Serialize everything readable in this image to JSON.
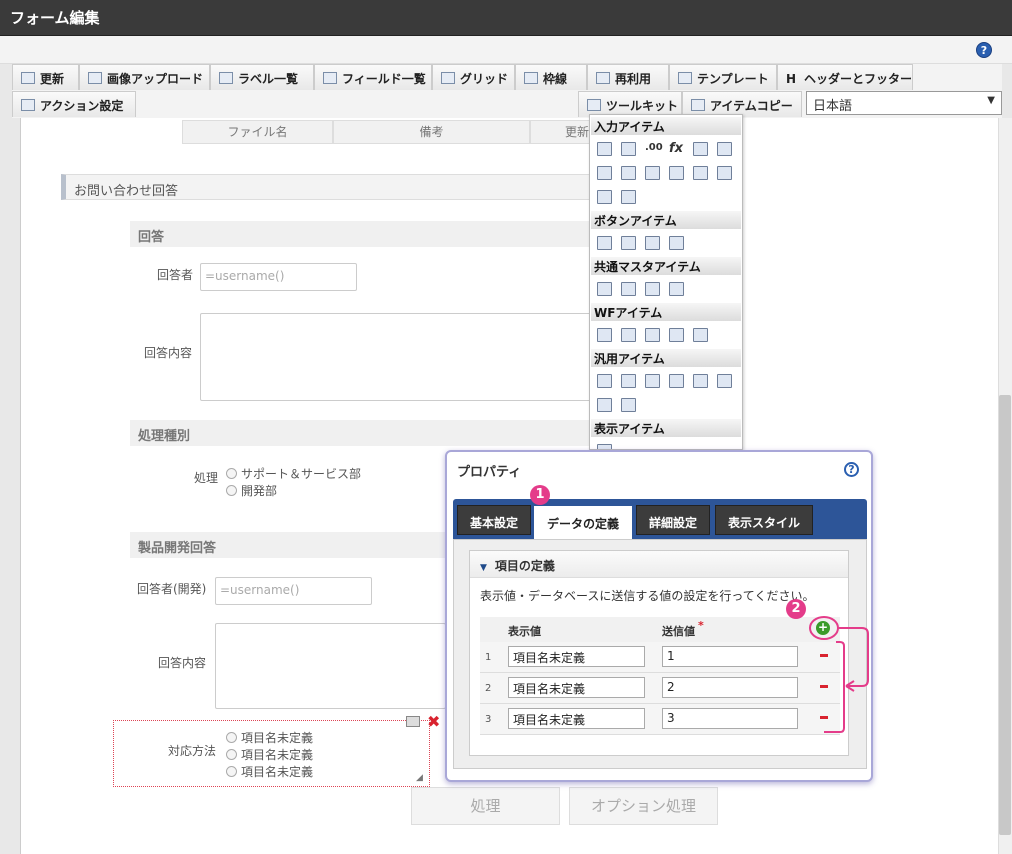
{
  "window": {
    "title": "フォーム編集",
    "help": "?"
  },
  "toolbar": {
    "row1": [
      "更新",
      "画像アップロード",
      "ラベル一覧",
      "フィールド一覧",
      "グリッド",
      "枠線",
      "再利用",
      "テンプレート",
      "ヘッダーとフッター"
    ],
    "header_footer_prefix": "H",
    "row2_left": "アクション設定",
    "row2_right": [
      "ツールキット",
      "アイテムコピー"
    ],
    "language": "日本語"
  },
  "form": {
    "grid_headers": [
      "ファイル名",
      "備考",
      "更新"
    ],
    "section_title": "お問い合わせ回答",
    "subsections": [
      "回答",
      "処理種別",
      "製品開発回答"
    ],
    "responder_label": "回答者",
    "responder_value": "=username()",
    "response_label": "回答内容",
    "process_label": "処理",
    "process_options": [
      "サポート＆サービス部",
      "開発部"
    ],
    "dev_responder_label": "回答者(開発)",
    "dev_responder_value": "=username()",
    "dev_response_label": "回答内容",
    "method_label": "対応方法",
    "method_options": [
      "項目名未定義",
      "項目名未定義",
      "項目名未定義"
    ],
    "buttons": [
      "処理",
      "オプション処理"
    ]
  },
  "palette": {
    "categories": [
      "入力アイテム",
      "ボタンアイテム",
      "共通マスタアイテム",
      "WFアイテム",
      "汎用アイテム",
      "表示アイテム"
    ]
  },
  "properties": {
    "title": "プロパティ",
    "help": "?",
    "tabs": [
      "基本設定",
      "データの定義",
      "詳細設定",
      "表示スタイル"
    ],
    "section": "項目の定義",
    "description": "表示値・データベースに送信する値の設定を行ってください。",
    "columns": [
      "表示値",
      "送信値"
    ],
    "required_mark": "*",
    "rows": [
      {
        "num": "1",
        "display": "項目名未定義",
        "value": "1"
      },
      {
        "num": "2",
        "display": "項目名未定義",
        "value": "2"
      },
      {
        "num": "3",
        "display": "項目名未定義",
        "value": "3"
      }
    ],
    "badges": [
      "1",
      "2"
    ],
    "colors": {
      "accent": "#e43c8a",
      "tabbar": "#2d5598",
      "minus": "#d9232f",
      "plus": "#3a9a2a"
    }
  }
}
